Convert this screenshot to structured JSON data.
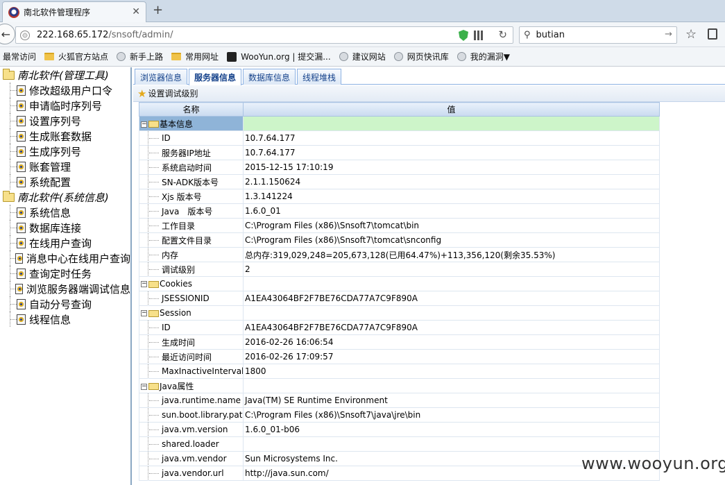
{
  "browser": {
    "tab_title": "南北软件管理程序",
    "tab_close": "✕",
    "new_tab": "+",
    "back_glyph": "←",
    "url_host": "222.168.65.172",
    "url_path": "/snsoft/admin/",
    "reload_glyph": "↻",
    "search_value": "butian",
    "search_go": "→",
    "star_glyph": "☆",
    "bookmarks": [
      {
        "label": "最常访问",
        "icon": "none"
      },
      {
        "label": "火狐官方站点",
        "icon": "folder"
      },
      {
        "label": "新手上路",
        "icon": "globe"
      },
      {
        "label": "常用网址",
        "icon": "folder"
      },
      {
        "label": "WooYun.org | 提交漏...",
        "icon": "wooyun"
      },
      {
        "label": "建议网站",
        "icon": "globe"
      },
      {
        "label": "网页快讯库",
        "icon": "globe"
      },
      {
        "label": "我的漏洞▼",
        "icon": "globe"
      }
    ]
  },
  "tree": {
    "group1": "南北软件(管理工具)",
    "group1_items": [
      "修改超级用户口令",
      "申请临时序列号",
      "设置序列号",
      "生成账套数据",
      "生成序列号",
      "账套管理",
      "系统配置"
    ],
    "group2": "南北软件(系统信息)",
    "group2_items": [
      "系统信息",
      "数据库连接",
      "在线用户查询",
      "消息中心在线用户查询",
      "查询定时任务",
      "浏览服务器端调试信息",
      "自动分号查询",
      "线程信息"
    ]
  },
  "tabs": [
    "浏览器信息",
    "服务器信息",
    "数据库信息",
    "线程堆栈"
  ],
  "active_tab": 1,
  "toolbar": {
    "set_debug_label": "设置调试级别"
  },
  "grid": {
    "col_name": "名称",
    "col_value": "值",
    "expanded_glyph": "−",
    "groups": [
      {
        "name": "基本信息",
        "rows": [
          [
            "ID",
            "10.7.64.177"
          ],
          [
            "服务器IP地址",
            "10.7.64.177"
          ],
          [
            "系统启动时间",
            "2015-12-15 17:10:19"
          ],
          [
            "SN-ADK版本号",
            "2.1.1.150624"
          ],
          [
            "Xjs 版本号",
            "1.3.141224"
          ],
          [
            "Java　版本号",
            "1.6.0_01"
          ],
          [
            "工作目录",
            "C:\\Program Files (x86)\\Snsoft7\\tomcat\\bin"
          ],
          [
            "配置文件目录",
            "C:\\Program Files (x86)\\Snsoft7\\tomcat\\snconfig"
          ],
          [
            "内存",
            "总内存:319,029,248=205,673,128(已用64.47%)+113,356,120(剩余35.53%)"
          ],
          [
            "调试级别",
            "2"
          ]
        ]
      },
      {
        "name": "Cookies",
        "rows": [
          [
            "JSESSIONID",
            "A1EA43064BF2F7BE76CDA77A7C9F890A"
          ]
        ]
      },
      {
        "name": "Session",
        "rows": [
          [
            "ID",
            "A1EA43064BF2F7BE76CDA77A7C9F890A"
          ],
          [
            "生成时间",
            "2016-02-26 16:06:54"
          ],
          [
            "最近访问时间",
            "2016-02-26 17:09:57"
          ],
          [
            "MaxInactiveInterval",
            "1800"
          ]
        ]
      },
      {
        "name": "Java属性",
        "rows": [
          [
            "java.runtime.name",
            "Java(TM) SE Runtime Environment"
          ],
          [
            "sun.boot.library.path",
            "C:\\Program Files (x86)\\Snsoft7\\java\\jre\\bin"
          ],
          [
            "java.vm.version",
            "1.6.0_01-b06"
          ],
          [
            "shared.loader",
            ""
          ],
          [
            "java.vm.vendor",
            "Sun Microsystems Inc."
          ],
          [
            "java.vendor.url",
            "http://java.sun.com/"
          ]
        ]
      }
    ]
  },
  "watermark": "www.wooyun.org"
}
